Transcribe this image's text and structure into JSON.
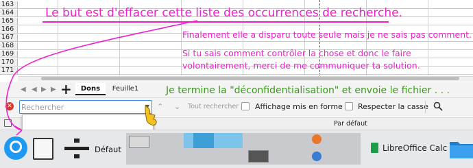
{
  "sheet": {
    "row_numbers": [
      "163",
      "164",
      "165",
      "166",
      "167",
      "168",
      "169",
      "170",
      "171"
    ]
  },
  "sheet_tabs": {
    "tabs": [
      {
        "label": "Dons",
        "active": true
      },
      {
        "label": "Feuille1",
        "active": false
      }
    ],
    "add_icon": "plus-icon",
    "nav_icons": [
      "first-sheet-icon",
      "prev-sheet-icon",
      "next-sheet-icon",
      "last-sheet-icon"
    ]
  },
  "find_toolbar": {
    "search_placeholder": "Rechercher",
    "search_value": "",
    "find_all_label": "Tout rechercher",
    "formatted_display_label": "Affichage mis en forme",
    "match_case_label": "Respecter la casse"
  },
  "status_bar": {
    "page_style": "Par défaut"
  },
  "taskbar": {
    "activity_label": "Défaut",
    "app_label": "LibreOffice Calc"
  },
  "annotations": {
    "title": "Le but est d'effacer cette liste des occurrences de recherche.",
    "note1": "Finalement elle a disparu toute seule mais je ne sais pas comment.",
    "note2": "Si tu sais comment contrôler la chose et donc le faire",
    "note3": "volontairement, merci de me communiquer ta solution.",
    "note4": "Je termine la \"déconfidentialisation\" et envoie le fichier . . ."
  },
  "colors": {
    "annotation": "#ee22cc",
    "annotation_green": "#3a9a1c",
    "accent": "#1d99f3"
  }
}
